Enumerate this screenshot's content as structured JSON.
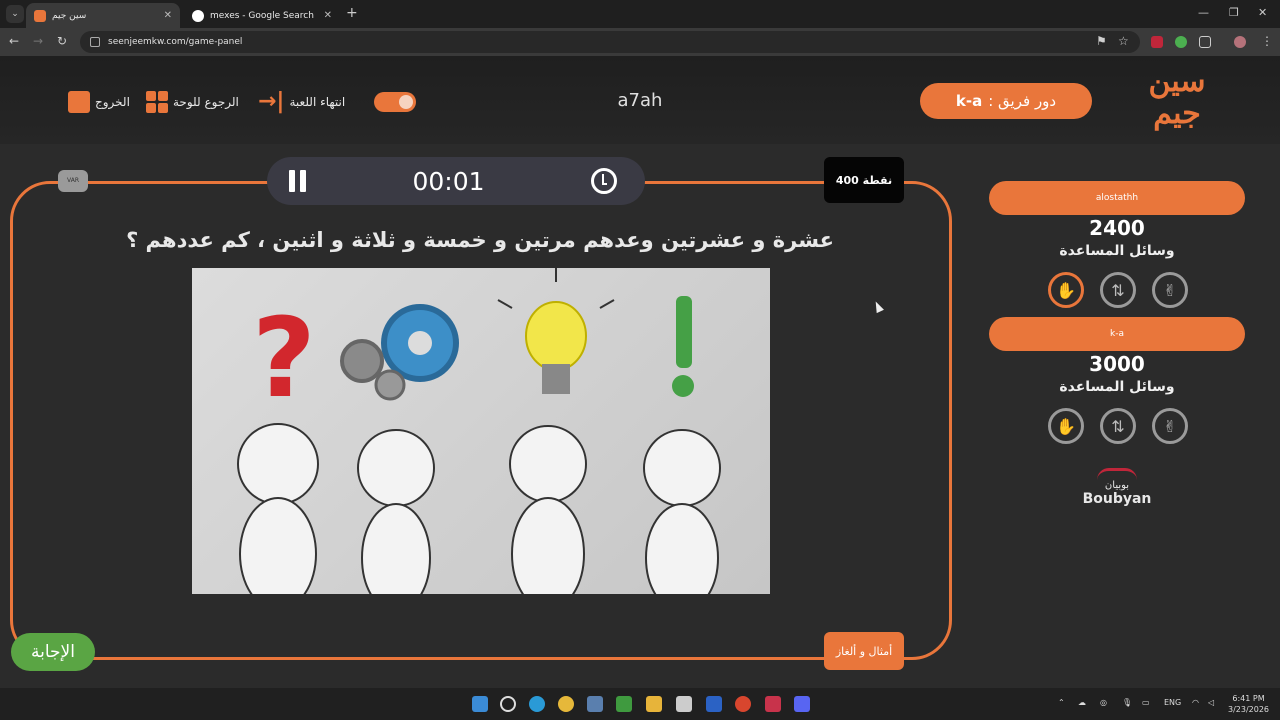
{
  "browser": {
    "tabs": [
      {
        "title": "سين جيم",
        "active": true
      },
      {
        "title": "mexes - Google Search",
        "active": false
      }
    ],
    "url": "seenjeemkw.com/game-panel"
  },
  "header": {
    "exit_label": "الخروج",
    "back_label": "الرجوع للوحة",
    "end_label": "انتهاء اللعبة",
    "game_name": "a7ah",
    "turn_prefix": "دور فريق :",
    "turn_team": "k-a",
    "logo_text": "سين جيم"
  },
  "question_panel": {
    "timer": "00:01",
    "points": "400 نقطة",
    "var_label": "VAR",
    "question": "عشرة و عشرتين وعدهم مرتين و خمسة و ثلاثة و اثنين ، كم عددهم ؟",
    "answer_button": "الإجابة",
    "category": "أمثال و ألغاز"
  },
  "teams": [
    {
      "name": "alostathh",
      "score": "2400",
      "aids_label": "وسائل المساعدة"
    },
    {
      "name": "k-a",
      "score": "3000",
      "aids_label": "وسائل المساعدة"
    }
  ],
  "sponsor": {
    "arabic": "بوبيان",
    "english": "Boubyan"
  },
  "taskbar": {
    "lang": "ENG",
    "time": "6:41 PM",
    "date": "3/23/2026"
  },
  "colors": {
    "accent": "#e9763b",
    "answer": "#5aa544",
    "background": "#2b2b2b"
  }
}
